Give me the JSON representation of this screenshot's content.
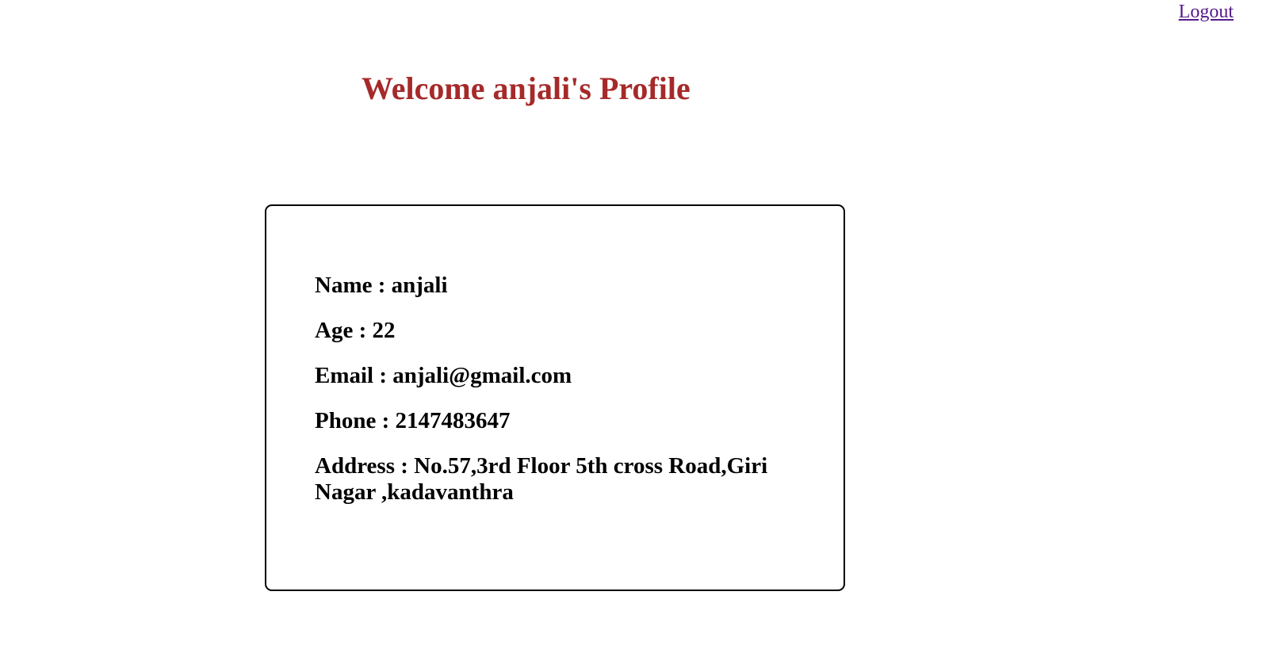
{
  "header": {
    "logout_label": "Logout",
    "title": "Welcome anjali's Profile",
    "title_color": "#a52a2a",
    "link_color": "#551a8b"
  },
  "profile": {
    "name_row": "Name : anjali",
    "age_row": "Age : 22",
    "email_row": "Email : anjali@gmail.com",
    "phone_row": "Phone : 2147483647",
    "address_row": "Address : No.57,3rd Floor 5th cross Road,Giri Nagar ,kadavanthra"
  }
}
